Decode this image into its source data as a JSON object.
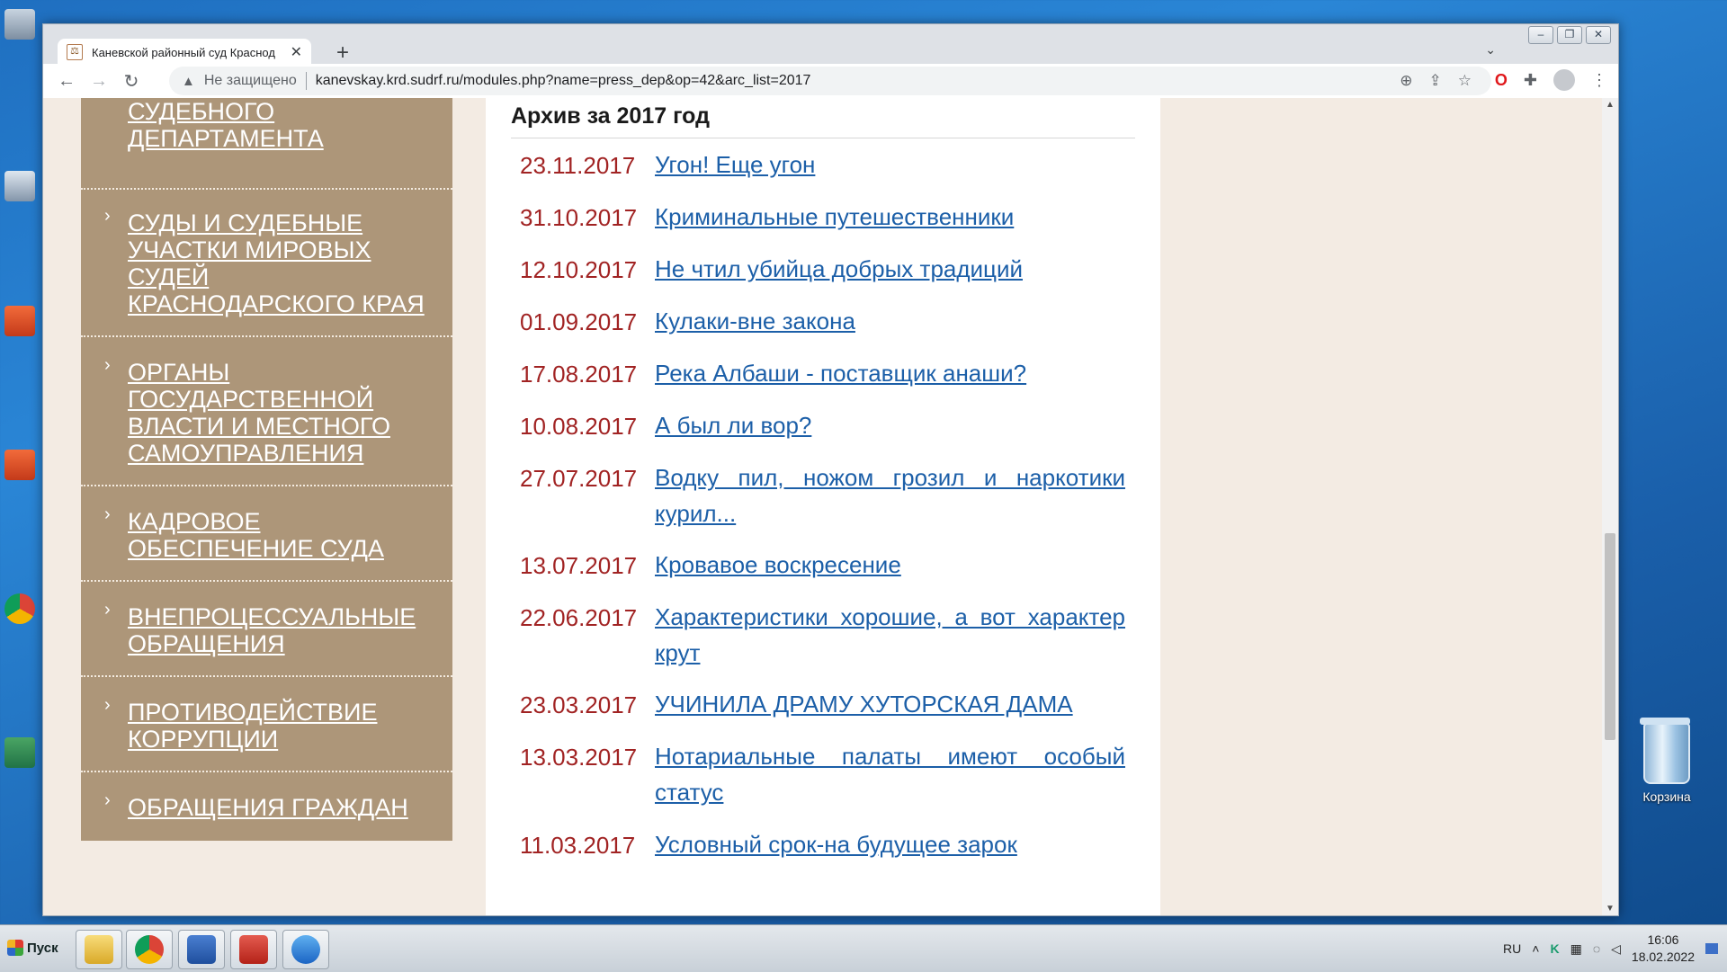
{
  "browser": {
    "tab_title": "Каневской районный суд Краснод",
    "security_label": "Не защищено",
    "url": "kanevskay.krd.sudrf.ru/modules.php?name=press_dep&op=42&arc_list=2017"
  },
  "sidebar": {
    "items": [
      {
        "label": "УПРАВЛЕНИЕ СУДЕБНОГО ДЕПАРТАМЕНТА"
      },
      {
        "label": "СУДЫ И СУДЕБНЫЕ УЧАСТКИ МИРОВЫХ СУДЕЙ КРАСНОДАРСКОГО КРАЯ"
      },
      {
        "label": "ОРГАНЫ ГОСУДАРСТВЕННОЙ ВЛАСТИ И МЕСТНОГО САМОУПРАВЛЕНИЯ"
      },
      {
        "label": "КАДРОВОЕ ОБЕСПЕЧЕНИЕ СУДА"
      },
      {
        "label": "ВНЕПРОЦЕССУАЛЬНЫЕ ОБРАЩЕНИЯ"
      },
      {
        "label": "ПРОТИВОДЕЙСТВИЕ КОРРУПЦИИ"
      },
      {
        "label": "ОБРАЩЕНИЯ ГРАЖДАН"
      }
    ]
  },
  "archive": {
    "title": "Архив за 2017 год",
    "items": [
      {
        "date": "23.11.2017",
        "title": "Угон! Еще угон"
      },
      {
        "date": "31.10.2017",
        "title": "Криминальные путешественники"
      },
      {
        "date": "12.10.2017",
        "title": "Не чтил убийца добрых традиций"
      },
      {
        "date": "01.09.2017",
        "title": "Кулаки-вне закона"
      },
      {
        "date": "17.08.2017",
        "title": "Река Албаши - поставщик анаши?"
      },
      {
        "date": "10.08.2017",
        "title": "А был ли вор?"
      },
      {
        "date": "27.07.2017",
        "title": "Водку пил, ножом грозил и наркотики курил..."
      },
      {
        "date": "13.07.2017",
        "title": "Кровавое воскресение"
      },
      {
        "date": "22.06.2017",
        "title": "Характеристики хорошие, а вот характер крут"
      },
      {
        "date": "23.03.2017",
        "title": "УЧИНИЛА ДРАМУ ХУТОРСКАЯ ДАМА"
      },
      {
        "date": "13.03.2017",
        "title": "Нотариальные палаты имеют особый статус"
      },
      {
        "date": "11.03.2017",
        "title": "Условный срок-на будущее зарок"
      }
    ]
  },
  "desktop": {
    "recycle_bin": "Корзина"
  },
  "taskbar": {
    "start_label": "Пуск",
    "language": "RU",
    "time": "16:06",
    "date": "18.02.2022"
  }
}
